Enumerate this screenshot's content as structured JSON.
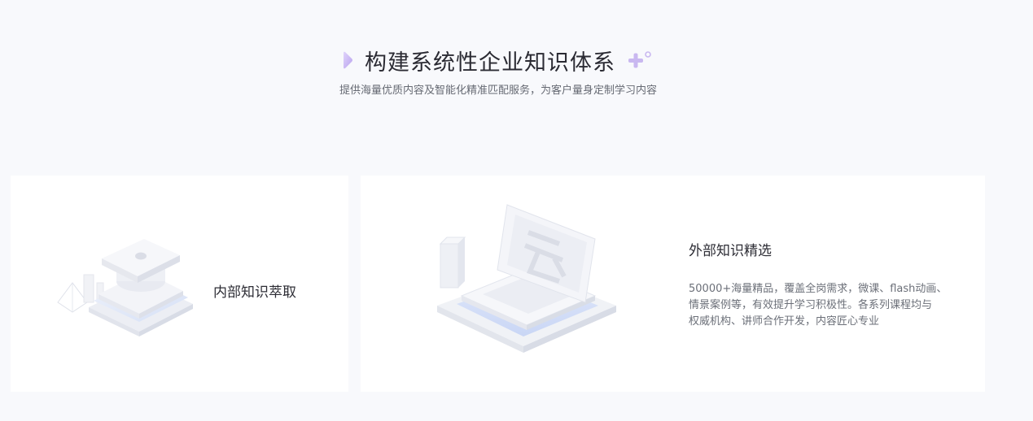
{
  "section": {
    "title": "构建系统性企业知识体系",
    "subtitle": "提供海量优质内容及智能化精准匹配服务，为客户量身定制学习内容"
  },
  "cards": [
    {
      "title": "内部知识萃取",
      "icon": "graduation-cap-illustration"
    },
    {
      "title": "外部知识精选",
      "icon": "laptop-cloud-illustration",
      "description_lines": [
        "50000+海量精品，覆盖全岗需求，微课、flash动画、",
        "情景案例等，有效提升学习积极性。各系列课程均与",
        "权威机构、讲师合作开发，内容匠心专业"
      ]
    }
  ],
  "colors": {
    "background": "#f8f9fc",
    "card": "#ffffff",
    "accent": "#c9b8f0"
  }
}
